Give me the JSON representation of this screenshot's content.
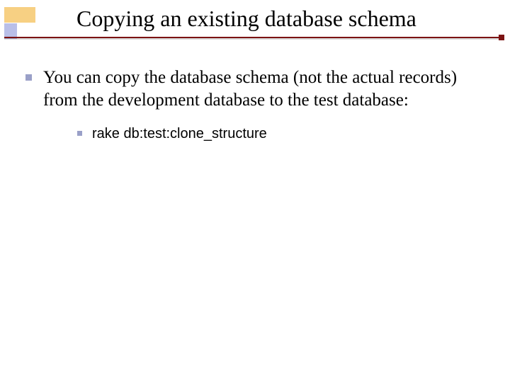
{
  "title": "Copying an existing database schema",
  "bullets": {
    "item1": {
      "text": "You can copy the database schema (not the actual records) from the development database to the test database:",
      "sub": {
        "item1": "rake db:test:clone_structure"
      }
    }
  },
  "colors": {
    "rule": "#7c1313",
    "bullet": "#9aa0c8",
    "deco_top": "#f7d083",
    "deco_left": "#b9bfe8"
  }
}
